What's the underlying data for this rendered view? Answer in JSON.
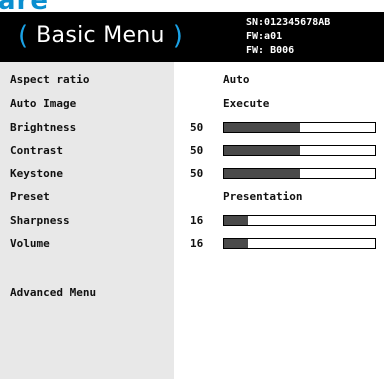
{
  "header": {
    "title": "Basic Menu",
    "paren_open": "(",
    "paren_close": ")",
    "serial": "SN:012345678AB",
    "fw1": "FW:a01",
    "fw2": "FW: B006"
  },
  "menu": {
    "aspect_ratio": {
      "label": "Aspect ratio",
      "value": "Auto"
    },
    "auto_image": {
      "label": "Auto Image",
      "value": "Execute"
    },
    "brightness": {
      "label": "Brightness",
      "value": "50",
      "level": 0.5
    },
    "contrast": {
      "label": "Contrast",
      "value": "50",
      "level": 0.5
    },
    "keystone": {
      "label": "Keystone",
      "value": "50",
      "level": 0.5
    },
    "preset": {
      "label": "Preset",
      "value": "Presentation"
    },
    "sharpness": {
      "label": "Sharpness",
      "value": "16",
      "level": 0.16
    },
    "volume": {
      "label": "Volume",
      "value": "16",
      "level": 0.16
    },
    "advanced": {
      "label": "Advanced Menu"
    }
  },
  "colors": {
    "accent": "#1aa2e6",
    "header_bg": "#000000",
    "left_panel": "#e8e8e8",
    "bar_fill": "#4a4a4a"
  }
}
